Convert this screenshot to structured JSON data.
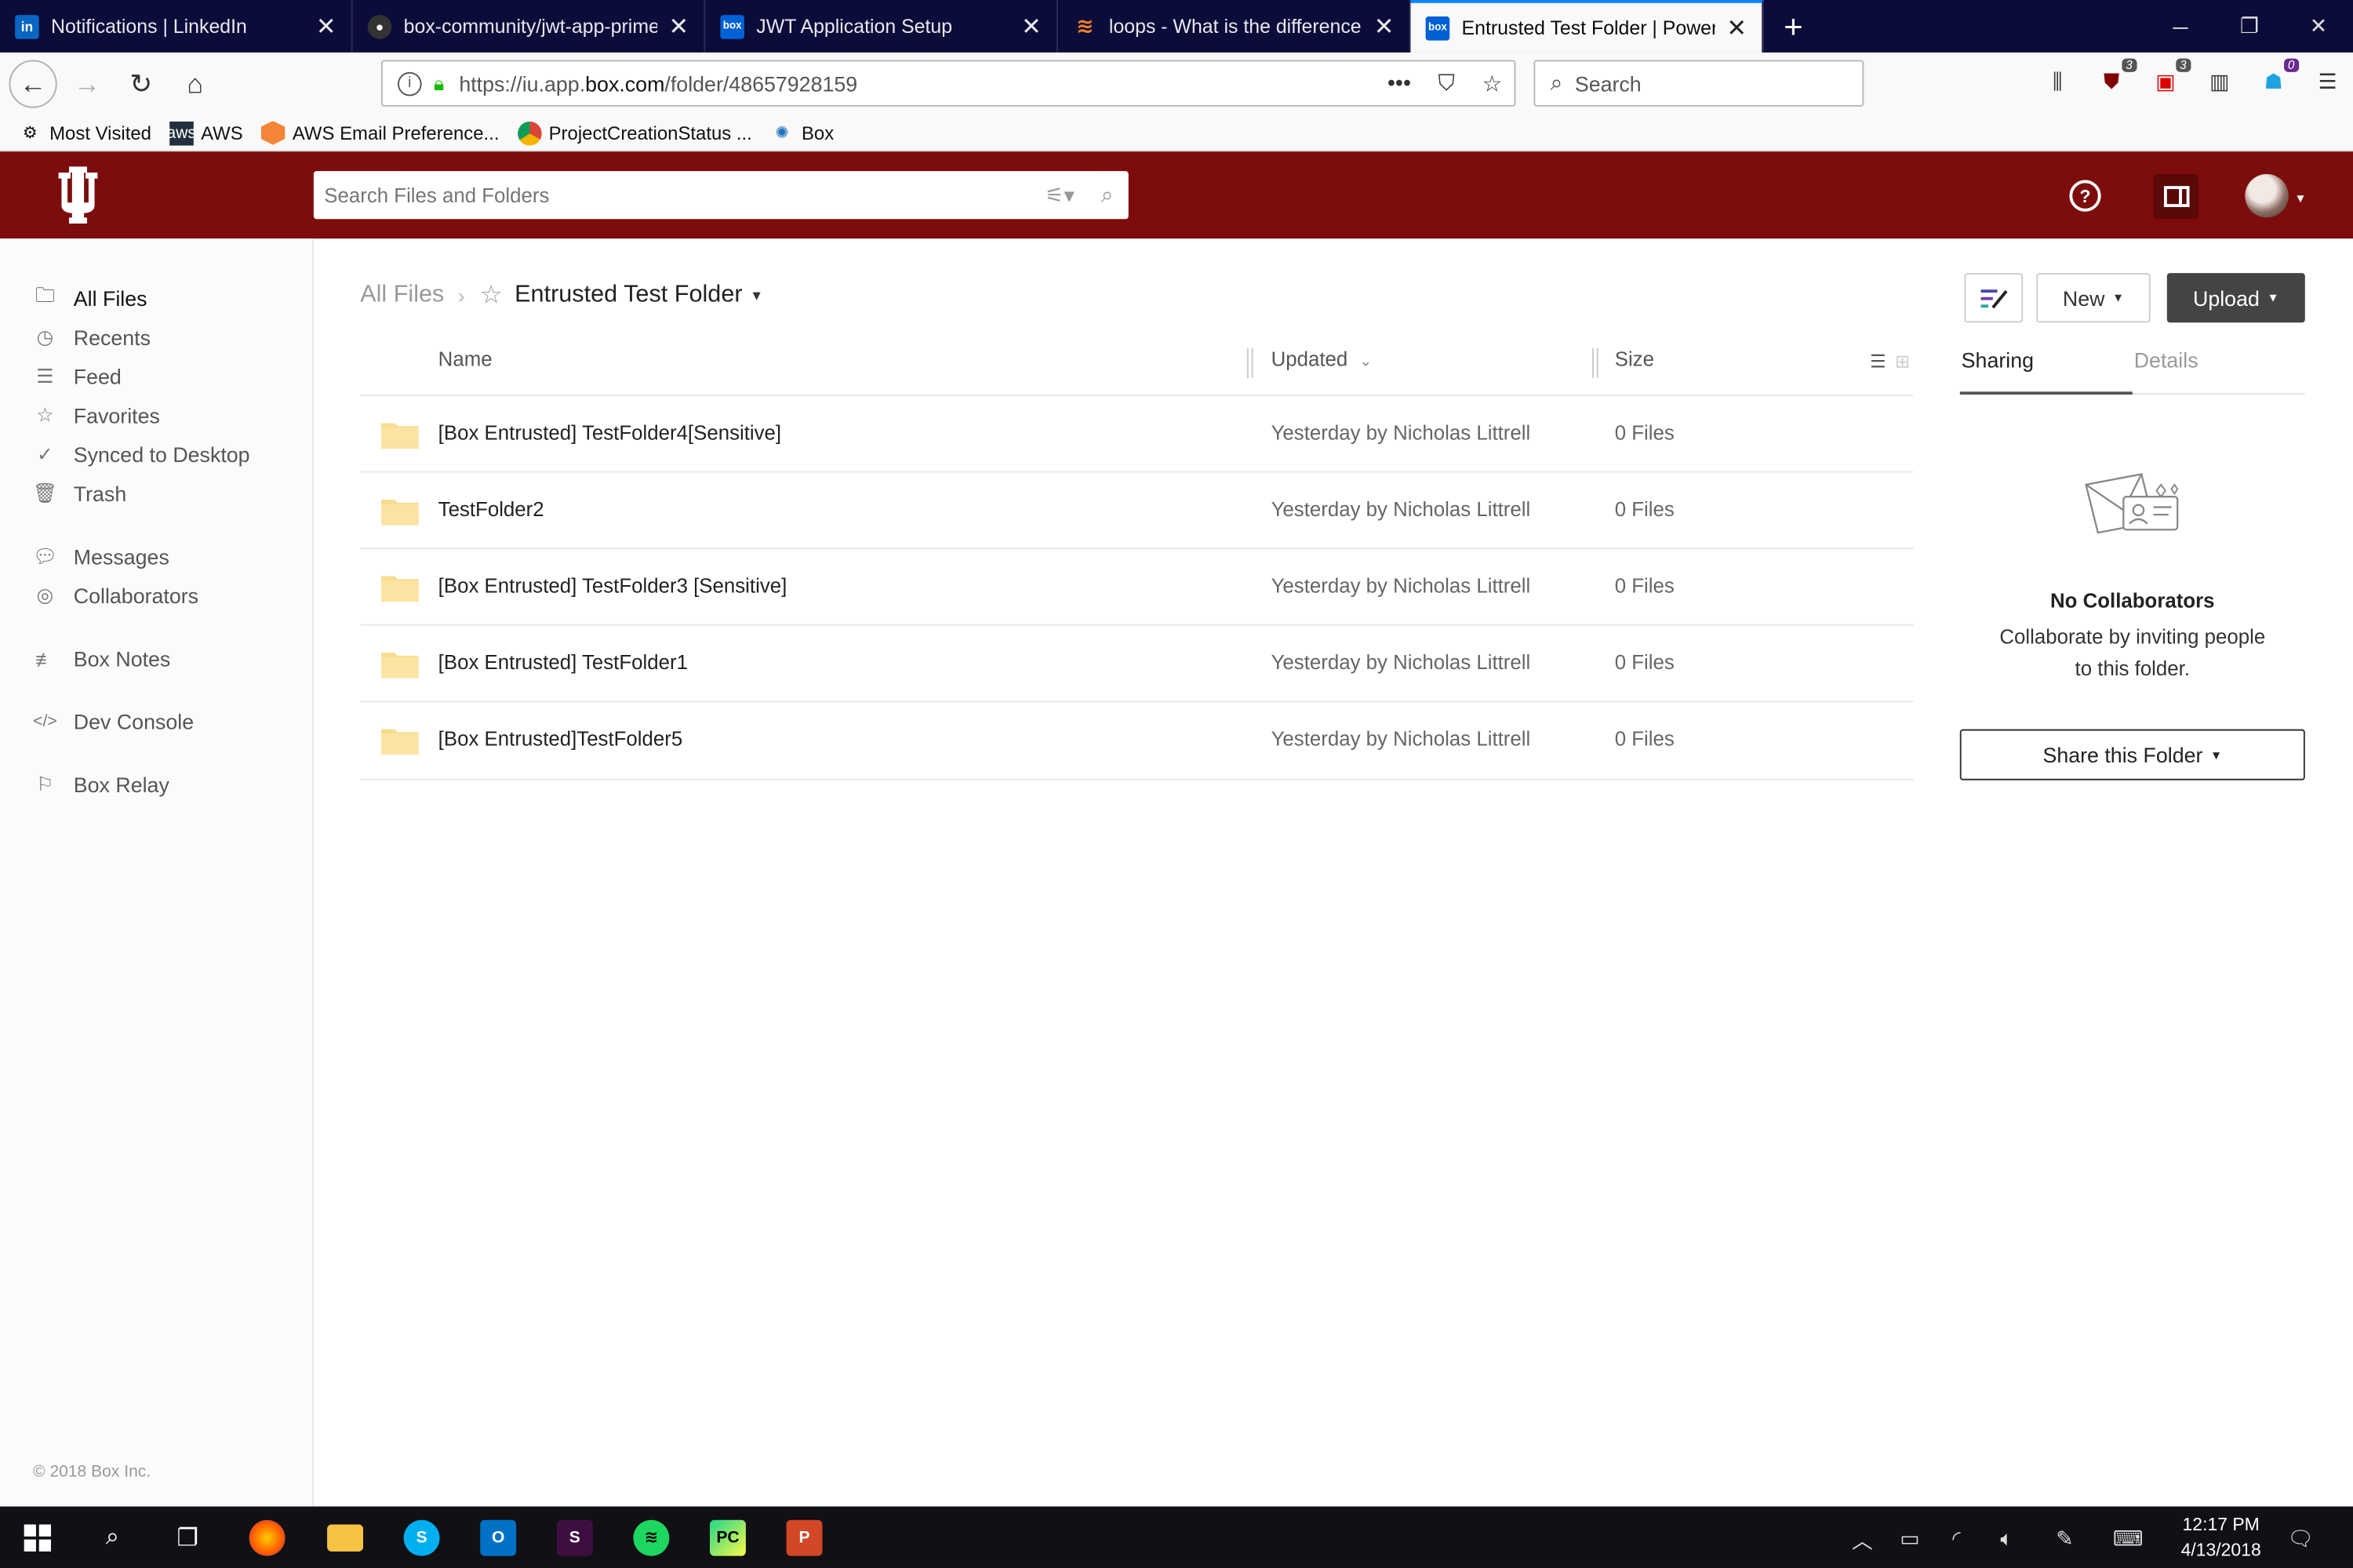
{
  "browser": {
    "tabs": [
      {
        "title": "Notifications | LinkedIn",
        "icon": "linkedin-icon"
      },
      {
        "title": "box-community/jwt-app-prime",
        "icon": "github-icon"
      },
      {
        "title": "JWT Application Setup",
        "icon": "box-icon"
      },
      {
        "title": "loops - What is the difference b",
        "icon": "stackoverflow-icon"
      },
      {
        "title": "Entrusted Test Folder | Powered",
        "icon": "box-icon",
        "active": true
      }
    ],
    "url_prefix": "https://iu.app.",
    "url_domain": "box.com",
    "url_path": "/folder/48657928159",
    "search_placeholder": "Search",
    "badges": {
      "ublock": "3",
      "ext_red": "3",
      "ghostery": "0"
    },
    "bookmarks": [
      "Most Visited",
      "AWS",
      "AWS Email Preference...",
      "ProjectCreationStatus ...",
      "Box"
    ]
  },
  "header": {
    "search_placeholder": "Search Files and Folders",
    "brand_color": "#7d0d0d"
  },
  "sidebar": {
    "items": [
      {
        "label": "All Files",
        "icon": "folder-icon"
      },
      {
        "label": "Recents",
        "icon": "clock-icon"
      },
      {
        "label": "Feed",
        "icon": "feed-icon"
      },
      {
        "label": "Favorites",
        "icon": "star-icon"
      },
      {
        "label": "Synced to Desktop",
        "icon": "check-circle-icon"
      },
      {
        "label": "Trash",
        "icon": "trash-icon"
      },
      {
        "label": "Messages",
        "icon": "message-icon"
      },
      {
        "label": "Collaborators",
        "icon": "person-icon"
      },
      {
        "label": "Box Notes",
        "icon": "notes-icon"
      },
      {
        "label": "Dev Console",
        "icon": "code-icon"
      },
      {
        "label": "Box Relay",
        "icon": "flag-icon"
      }
    ],
    "copyright": "© 2018 Box Inc."
  },
  "main": {
    "breadcrumb_root": "All Files",
    "folder_title": "Entrusted Test Folder",
    "new_label": "New",
    "upload_label": "Upload",
    "columns": {
      "name": "Name",
      "updated": "Updated",
      "size": "Size"
    },
    "rows": [
      {
        "name": "[Box Entrusted] TestFolder4[Sensitive]",
        "updated": "Yesterday by Nicholas Littrell",
        "size": "0 Files"
      },
      {
        "name": "TestFolder2",
        "updated": "Yesterday by Nicholas Littrell",
        "size": "0 Files"
      },
      {
        "name": "[Box Entrusted] TestFolder3 [Sensitive]",
        "updated": "Yesterday by Nicholas Littrell",
        "size": "0 Files"
      },
      {
        "name": "[Box Entrusted] TestFolder1",
        "updated": "Yesterday by Nicholas Littrell",
        "size": "0 Files"
      },
      {
        "name": "[Box Entrusted]TestFolder5",
        "updated": "Yesterday by Nicholas Littrell",
        "size": "0 Files"
      }
    ]
  },
  "right_panel": {
    "tabs": [
      "Sharing",
      "Details"
    ],
    "empty_title": "No Collaborators",
    "empty_desc_line1": "Collaborate by inviting people",
    "empty_desc_line2": "to this folder.",
    "share_button": "Share this Folder"
  },
  "taskbar": {
    "time": "12:17 PM",
    "date": "4/13/2018"
  }
}
